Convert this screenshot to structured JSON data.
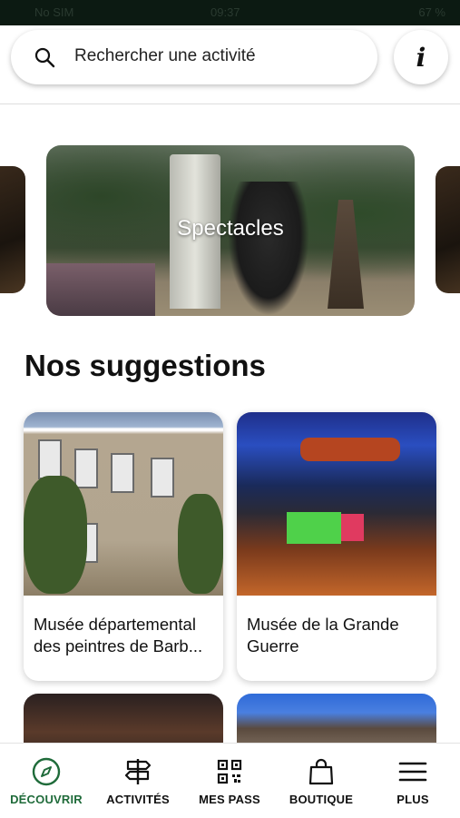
{
  "status_bar": {
    "left": "No SIM",
    "center": "09:37",
    "right": "67 %"
  },
  "search": {
    "placeholder": "Rechercher une activité"
  },
  "info_button": {
    "label": "i"
  },
  "carousel": {
    "main_label": "Spectacles"
  },
  "suggestions": {
    "title": "Nos suggestions",
    "cards": [
      {
        "title": "Musée départemental des peintres de Barb..."
      },
      {
        "title": "Musée de la Grande Guerre"
      }
    ]
  },
  "nav": {
    "items": [
      {
        "label": "DÉCOUVRIR",
        "icon": "compass-icon",
        "active": true
      },
      {
        "label": "ACTIVITÉS",
        "icon": "signpost-icon"
      },
      {
        "label": "MES PASS",
        "icon": "qr-code-icon"
      },
      {
        "label": "BOUTIQUE",
        "icon": "shopping-bag-icon"
      },
      {
        "label": "PLUS",
        "icon": "menu-icon"
      }
    ],
    "active_color": "#1f6b3a"
  }
}
